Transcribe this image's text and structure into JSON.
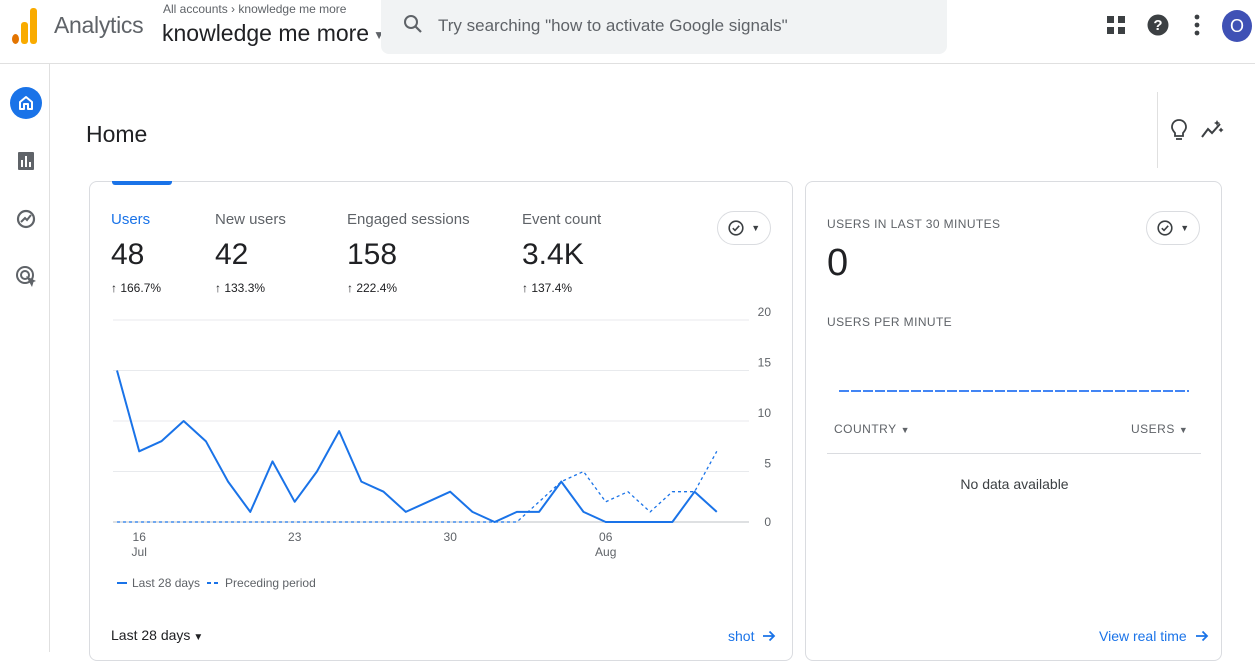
{
  "header": {
    "app_name": "Analytics",
    "breadcrumb_root": "All accounts",
    "breadcrumb_sep": "›",
    "breadcrumb_current": "knowledge me more",
    "property_name": "knowledge me more",
    "search_placeholder": "Try searching \"how to activate Google signals\"",
    "avatar_initial": "O"
  },
  "icons": {
    "logo": "analytics-logo-icon",
    "search": "search-icon",
    "apps": "apps-grid-icon",
    "help": "help-icon",
    "more": "more-vert-icon",
    "nav": [
      "home-icon",
      "reports-icon",
      "explore-icon",
      "advertising-icon"
    ],
    "insights": "lightbulb-icon",
    "trend": "insights-trend-icon"
  },
  "colors": {
    "accent": "#1a73e8",
    "logo_orange": "#f9ab00",
    "logo_dark": "#e37400",
    "avatar": "#3f51b5"
  },
  "page": {
    "title": "Home"
  },
  "overview": {
    "metrics": [
      {
        "label": "Users",
        "value": "48",
        "change": "↑ 166.7%",
        "selected": true
      },
      {
        "label": "New users",
        "value": "42",
        "change": "↑ 133.3%",
        "selected": false
      },
      {
        "label": "Engaged sessions",
        "value": "158",
        "change": "↑ 222.4%",
        "selected": false
      },
      {
        "label": "Event count",
        "value": "3.4K",
        "change": "↑ 137.4%",
        "selected": false
      }
    ],
    "legend": {
      "current": "Last 28 days",
      "previous": "Preceding period"
    },
    "date_range": "Last 28 days",
    "footer_link": "shot"
  },
  "chart_data": {
    "type": "line",
    "x": [
      "Jul 15",
      "Jul 16",
      "Jul 17",
      "Jul 18",
      "Jul 19",
      "Jul 20",
      "Jul 21",
      "Jul 22",
      "Jul 23",
      "Jul 24",
      "Jul 25",
      "Jul 26",
      "Jul 27",
      "Jul 28",
      "Jul 29",
      "Jul 30",
      "Jul 31",
      "Aug 1",
      "Aug 2",
      "Aug 3",
      "Aug 4",
      "Aug 5",
      "Aug 6",
      "Aug 7",
      "Aug 8",
      "Aug 9",
      "Aug 10",
      "Aug 11",
      "Aug 12"
    ],
    "x_ticks": [
      {
        "index": 1,
        "label": "16",
        "sublabel": "Jul"
      },
      {
        "index": 8,
        "label": "23",
        "sublabel": ""
      },
      {
        "index": 15,
        "label": "30",
        "sublabel": ""
      },
      {
        "index": 22,
        "label": "06",
        "sublabel": "Aug"
      }
    ],
    "y_ticks": [
      0,
      5,
      10,
      15,
      20
    ],
    "ylim": [
      0,
      20
    ],
    "series": [
      {
        "name": "Last 28 days",
        "style": "solid",
        "color": "#1a73e8",
        "values": [
          15,
          7,
          8,
          10,
          8,
          4,
          1,
          6,
          2,
          5,
          9,
          4,
          3,
          1,
          2,
          3,
          1,
          0,
          1,
          1,
          4,
          1,
          0,
          0,
          0,
          0,
          3,
          1
        ]
      },
      {
        "name": "Preceding period",
        "style": "dashed",
        "color": "#1a73e8",
        "values": [
          0,
          0,
          0,
          0,
          0,
          0,
          0,
          0,
          0,
          0,
          0,
          0,
          0,
          0,
          0,
          0,
          0,
          0,
          0,
          2,
          4,
          5,
          2,
          3,
          1,
          3,
          3,
          7
        ]
      }
    ]
  },
  "realtime": {
    "title": "USERS IN LAST 30 MINUTES",
    "value": "0",
    "subtitle": "USERS PER MINUTE",
    "col_country": "COUNTRY",
    "col_users": "USERS",
    "empty": "No data available",
    "link": "View real time"
  }
}
